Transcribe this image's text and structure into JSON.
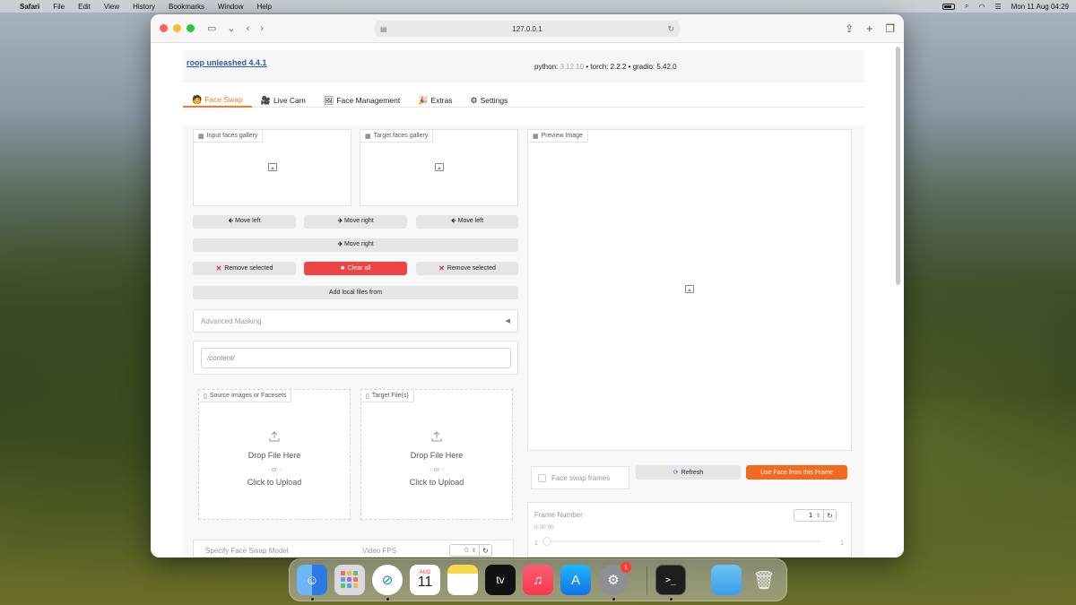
{
  "menubar": {
    "app": "Safari",
    "items": [
      "File",
      "Edit",
      "View",
      "History",
      "Bookmarks",
      "Window",
      "Help"
    ],
    "clock": "Mon 11 Aug  04:29"
  },
  "browser": {
    "url": "127.0.0.1"
  },
  "app": {
    "title": "roop unleashed 4.4.1",
    "versions_prefix": "python: ",
    "python_version": "3.12.10",
    "versions_rest": " • torch: 2.2.2 • gradio: 5.42.0"
  },
  "tabs": [
    {
      "label": "Face Swap",
      "icon": "face-swap-icon",
      "active": true
    },
    {
      "label": "Live Cam",
      "icon": "camera-icon",
      "active": false
    },
    {
      "label": "Face Management",
      "icon": "face-management-icon",
      "active": false
    },
    {
      "label": "Extras",
      "icon": "extras-icon",
      "active": false
    },
    {
      "label": "Settings",
      "icon": "gear-icon",
      "active": false
    }
  ],
  "galleries": {
    "input_label": "Input faces gallery",
    "target_label": "Target faces gallery",
    "preview_label": "Preview Image"
  },
  "buttons": {
    "move_left_1": "🡸 Move left",
    "move_right_1": "🡺 Move right",
    "move_left_2": "🡸 Move left",
    "move_right_2": "🡺 Move right",
    "remove_selected_1": "Remove selected",
    "clear_all": "Clear all",
    "remove_selected_2": "Remove selected",
    "add_local_files": "Add local files from",
    "refresh": "Refresh",
    "use_face": "Use Face from this Frame"
  },
  "advanced_masking": "Advanced Masking",
  "path_input": {
    "placeholder": "/content/"
  },
  "uploads": {
    "source_label": "Source Images or Facesets",
    "target_label": "Target File(s)",
    "drop": "Drop File Here",
    "or": "- or -",
    "click": "Click to Upload"
  },
  "face_swap_frames": "Face swap frames",
  "frame": {
    "label": "Frame Number",
    "time": "0:00:00",
    "value": "1",
    "min": "1",
    "max": "1"
  },
  "bottom": {
    "model_label": "Specify Face Swap Model",
    "fps_label": "Video FPS",
    "fps_value": "0"
  },
  "dock": {
    "calendar_month": "AUG",
    "calendar_day": "11",
    "settings_badge": "1",
    "tv_label": "tv"
  },
  "colors": {
    "accent": "#f07b2c",
    "link": "#2a5db0",
    "danger": "#ef4444",
    "primary_button": "#f36a1f"
  }
}
